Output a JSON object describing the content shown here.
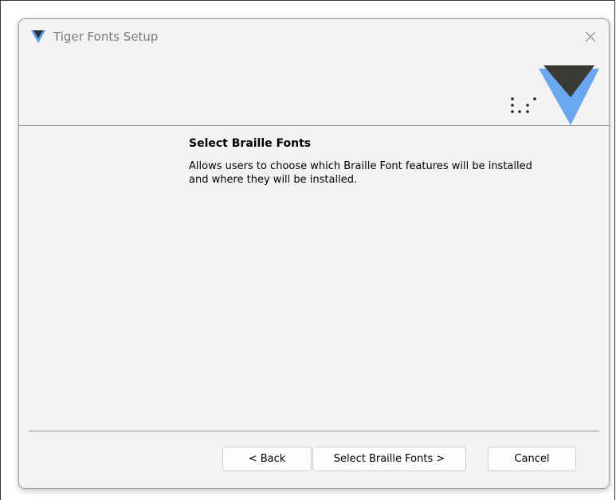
{
  "window": {
    "title": "Tiger Fonts Setup"
  },
  "content": {
    "title": "Select Braille Fonts",
    "description": "Allows users to choose which Braille Font features will be installed and where they will be installed."
  },
  "buttons": {
    "back_label": "< Back",
    "next_label": "Select Braille Fonts >",
    "cancel_label": "Cancel"
  },
  "icons": {
    "app_logo": "tiger-logo-icon",
    "close": "close-icon",
    "braille": "braille-dots-icon",
    "brand": "tiger-brand-logo"
  },
  "colors": {
    "logo_blue": "#5b9bea",
    "logo_dark": "#3a3a37",
    "window_bg": "#f3f3f3",
    "divider": "#8f8f8f"
  }
}
